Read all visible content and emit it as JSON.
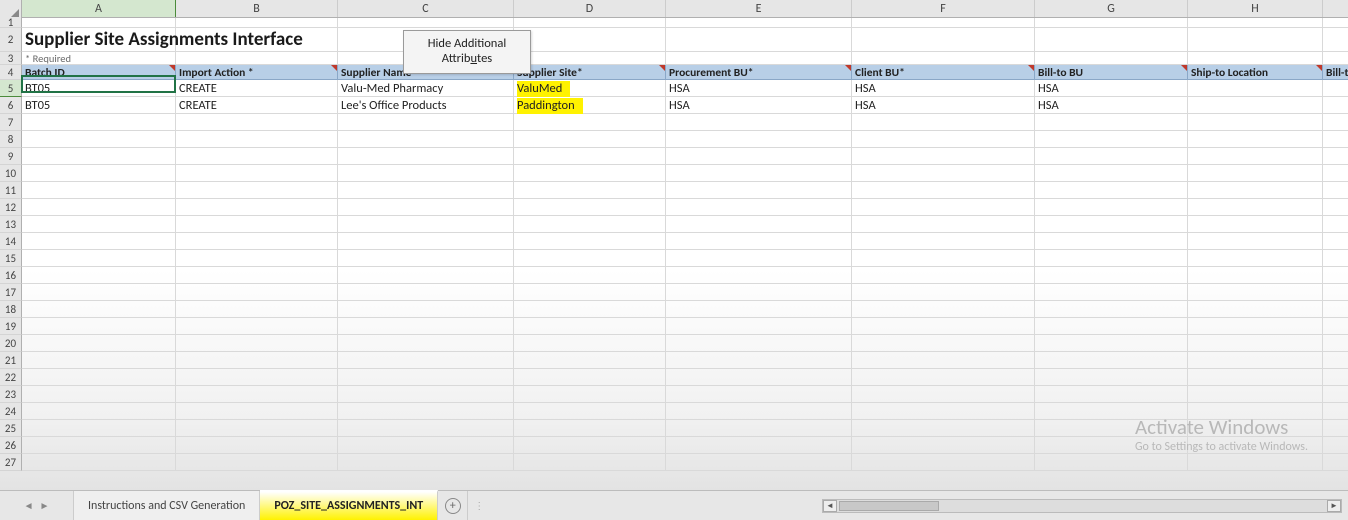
{
  "title": "Supplier Site Assignments Interface",
  "required_note": "* Required",
  "hide_button_line1": "Hide Additional",
  "hide_button_line2_pre": "Attrib",
  "hide_button_line2_u": "u",
  "hide_button_line2_post": "tes",
  "col_headers": [
    "A",
    "B",
    "C",
    "D",
    "E",
    "F",
    "G",
    "H"
  ],
  "row_numbers": [
    "1",
    "2",
    "3",
    "4",
    "5",
    "6",
    "7",
    "8",
    "9",
    "10",
    "11",
    "12",
    "13",
    "14",
    "15",
    "16",
    "17",
    "18",
    "19",
    "20",
    "21",
    "22",
    "23",
    "24",
    "25",
    "26",
    "27"
  ],
  "headers": {
    "A": "Batch ID",
    "B": "Import Action *",
    "C": "Supplier Name*",
    "D": "Supplier Site*",
    "E": "Procurement BU*",
    "F": "Client BU*",
    "G": "Bill-to BU",
    "H": "Ship-to Location",
    "I": "Bill-to"
  },
  "rows": [
    {
      "A": "BT05",
      "B": "CREATE",
      "C": "Valu-Med Pharmacy",
      "D": "ValuMed",
      "E": "HSA",
      "F": "HSA",
      "G": "HSA",
      "H": ""
    },
    {
      "A": "BT05",
      "B": "CREATE",
      "C": "Lee's Office Products",
      "D": "Paddington",
      "E": "HSA",
      "F": "HSA",
      "G": "HSA",
      "H": ""
    }
  ],
  "tabs": {
    "tab1": "Instructions and CSV Generation",
    "tab2": "POZ_SITE_ASSIGNMENTS_INT"
  },
  "watermark": {
    "line1": "Activate Windows",
    "line2": "Go to Settings to activate Windows."
  }
}
